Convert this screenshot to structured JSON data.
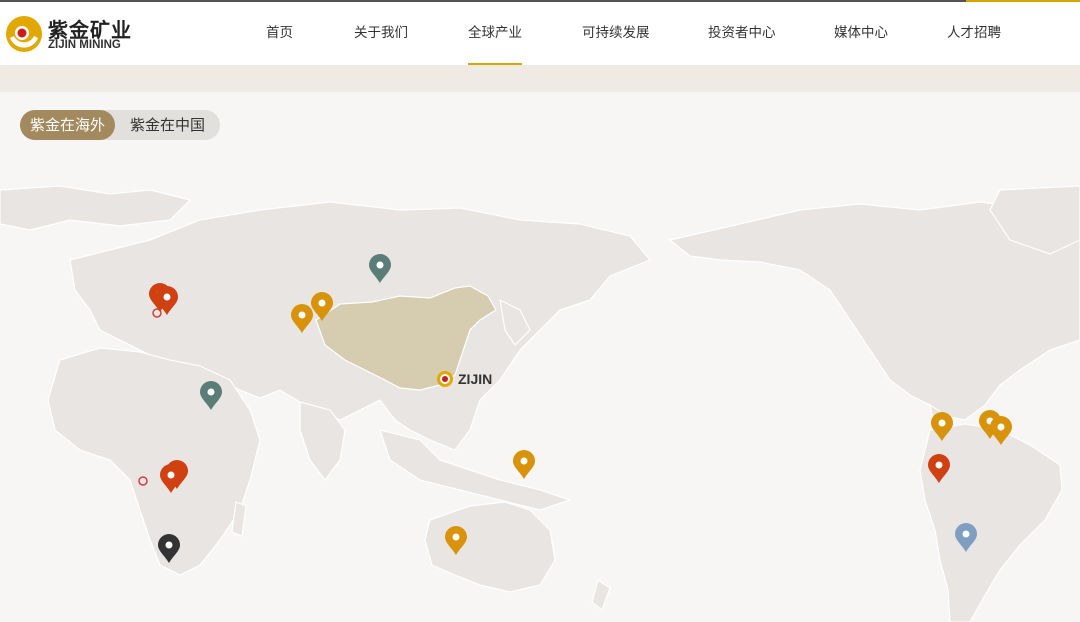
{
  "logo": {
    "name_cn": "紫金矿业",
    "name_en": "ZIJIN MINING"
  },
  "nav": {
    "items": [
      {
        "label": "首页"
      },
      {
        "label": "关于我们"
      },
      {
        "label": "全球产业"
      },
      {
        "label": "可持续发展"
      },
      {
        "label": "投资者中心"
      },
      {
        "label": "媒体中心"
      },
      {
        "label": "人才招聘"
      }
    ],
    "active": "全球产业"
  },
  "tabs": [
    {
      "label": "紫金在海外",
      "active": true
    },
    {
      "label": "紫金在中国",
      "active": false
    }
  ],
  "map": {
    "hq_label": "ZIJIN",
    "colors": {
      "land": "#e8e5e2",
      "china": "#d6ccaf",
      "ocean": "#f7f6f4",
      "pin_gold": "#d8930a",
      "pin_red": "#d04010",
      "pin_teal": "#5b7d78",
      "pin_dark": "#333333",
      "pin_blue": "#7f9fc2"
    },
    "pins": [
      {
        "kind": "teal"
      },
      {
        "kind": "gold"
      },
      {
        "kind": "gold"
      },
      {
        "kind": "red"
      },
      {
        "kind": "red"
      },
      {
        "kind": "teal"
      },
      {
        "kind": "red"
      },
      {
        "kind": "red"
      },
      {
        "kind": "dark"
      },
      {
        "kind": "gold"
      },
      {
        "kind": "gold"
      },
      {
        "kind": "gold"
      },
      {
        "kind": "gold"
      },
      {
        "kind": "gold"
      },
      {
        "kind": "red"
      },
      {
        "kind": "blue"
      }
    ]
  }
}
